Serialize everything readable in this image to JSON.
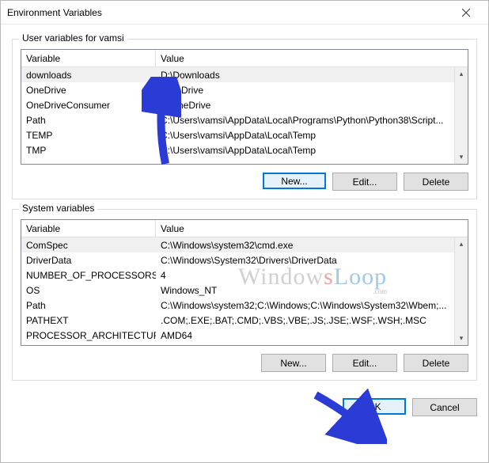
{
  "window": {
    "title": "Environment Variables"
  },
  "user_group": {
    "legend": "User variables for vamsi",
    "header_variable": "Variable",
    "header_value": "Value",
    "selected_index": 0,
    "rows": [
      {
        "name": "downloads",
        "value": "D:\\Downloads"
      },
      {
        "name": "OneDrive",
        "value": "   \\OneDrive"
      },
      {
        "name": "OneDriveConsumer",
        "value": "F.\\OneDrive"
      },
      {
        "name": "Path",
        "value": "C:\\Users\\vamsi\\AppData\\Local\\Programs\\Python\\Python38\\Script..."
      },
      {
        "name": "TEMP",
        "value": "C:\\Users\\vamsi\\AppData\\Local\\Temp"
      },
      {
        "name": "TMP",
        "value": "C:\\Users\\vamsi\\AppData\\Local\\Temp"
      }
    ],
    "buttons": {
      "new": "New...",
      "edit": "Edit...",
      "delete": "Delete"
    }
  },
  "system_group": {
    "legend": "System variables",
    "header_variable": "Variable",
    "header_value": "Value",
    "selected_index": 0,
    "rows": [
      {
        "name": "ComSpec",
        "value": "C:\\Windows\\system32\\cmd.exe"
      },
      {
        "name": "DriverData",
        "value": "C:\\Windows\\System32\\Drivers\\DriverData"
      },
      {
        "name": "NUMBER_OF_PROCESSORS",
        "value": "4"
      },
      {
        "name": "OS",
        "value": "Windows_NT"
      },
      {
        "name": "Path",
        "value": "C:\\Windows\\system32;C:\\Windows;C:\\Windows\\System32\\Wbem;..."
      },
      {
        "name": "PATHEXT",
        "value": ".COM;.EXE;.BAT;.CMD;.VBS;.VBE;.JS;.JSE;.WSF;.WSH;.MSC"
      },
      {
        "name": "PROCESSOR_ARCHITECTURE",
        "value": "AMD64"
      }
    ],
    "buttons": {
      "new": "New...",
      "edit": "Edit...",
      "delete": "Delete"
    }
  },
  "dialog_buttons": {
    "ok": "OK",
    "cancel": "Cancel"
  },
  "watermark": {
    "part1": "Window",
    "part2": "s",
    "part3": "Loop",
    "sub": ".com"
  }
}
